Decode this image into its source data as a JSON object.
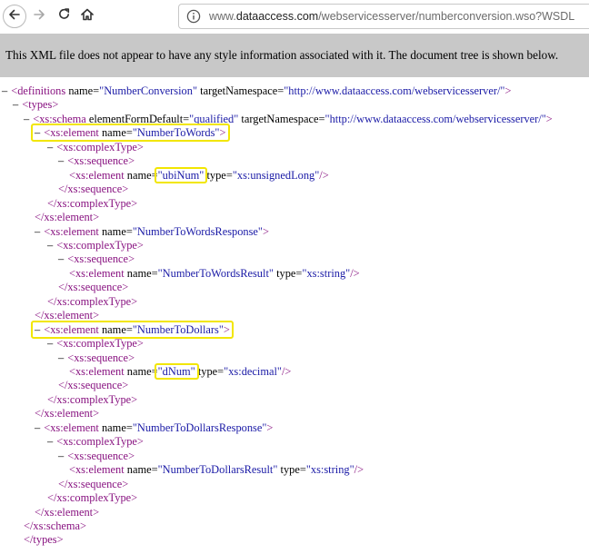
{
  "browser": {
    "back_icon": "arrow-left-icon",
    "forward_icon": "arrow-right-icon",
    "reload_icon": "reload-icon",
    "home_icon": "home-icon",
    "info_icon": "info-icon",
    "url_prefix": "www.",
    "url_main": "dataaccess.com",
    "url_rest": "/webservicesserver/numberconversion.wso?WSDL"
  },
  "banner": {
    "message": "This XML file does not appear to have any style information associated with it. The document tree is shown below."
  },
  "colors": {
    "tag": "#881280",
    "value": "#1a1aa6",
    "highlight": "#f2e600",
    "banner_bg": "#c8c8c8"
  },
  "xml_lines": [
    {
      "fold": "–",
      "tag": "<definitions",
      "attrs": [
        {
          "name": "name",
          "value": "NumberConversion"
        },
        {
          "name": "targetNamespace",
          "value": "http://www.dataaccess.com/webservicesserver/"
        }
      ],
      "end": ">"
    },
    {
      "fold": "–",
      "tag": "<types",
      "attrs": [],
      "end": ">"
    },
    {
      "fold": "–",
      "tag": "<xs:schema",
      "attrs": [
        {
          "name": "elementFormDefault",
          "value": "qualified"
        },
        {
          "name": "targetNamespace",
          "value": "http://www.dataaccess.com/webservicesserver/"
        }
      ],
      "end": ">"
    },
    {
      "fold": "–",
      "tag": "<xs:element",
      "attrs": [
        {
          "name": "name",
          "value": "NumberToWords"
        }
      ],
      "end": ">"
    },
    {
      "fold": "–",
      "tag": "<xs:complexType",
      "attrs": [],
      "end": ">"
    },
    {
      "fold": "–",
      "tag": "<xs:sequence",
      "attrs": [],
      "end": ">"
    },
    {
      "fold": "",
      "tag": "<xs:element",
      "attrs": [
        {
          "name": "name",
          "value": "ubiNum"
        },
        {
          "name": "type",
          "value": "xs:unsignedLong"
        }
      ],
      "end": "/>"
    },
    {
      "fold": "",
      "tag": "</xs:sequence",
      "attrs": [],
      "end": ">"
    },
    {
      "fold": "",
      "tag": "</xs:complexType",
      "attrs": [],
      "end": ">"
    },
    {
      "fold": "",
      "tag": "</xs:element",
      "attrs": [],
      "end": ">"
    },
    {
      "fold": "–",
      "tag": "<xs:element",
      "attrs": [
        {
          "name": "name",
          "value": "NumberToWordsResponse"
        }
      ],
      "end": ">"
    },
    {
      "fold": "–",
      "tag": "<xs:complexType",
      "attrs": [],
      "end": ">"
    },
    {
      "fold": "–",
      "tag": "<xs:sequence",
      "attrs": [],
      "end": ">"
    },
    {
      "fold": "",
      "tag": "<xs:element",
      "attrs": [
        {
          "name": "name",
          "value": "NumberToWordsResult"
        },
        {
          "name": "type",
          "value": "xs:string"
        }
      ],
      "end": "/>"
    },
    {
      "fold": "",
      "tag": "</xs:sequence",
      "attrs": [],
      "end": ">"
    },
    {
      "fold": "",
      "tag": "</xs:complexType",
      "attrs": [],
      "end": ">"
    },
    {
      "fold": "",
      "tag": "</xs:element",
      "attrs": [],
      "end": ">"
    },
    {
      "fold": "–",
      "tag": "<xs:element",
      "attrs": [
        {
          "name": "name",
          "value": "NumberToDollars"
        }
      ],
      "end": ">"
    },
    {
      "fold": "–",
      "tag": "<xs:complexType",
      "attrs": [],
      "end": ">"
    },
    {
      "fold": "–",
      "tag": "<xs:sequence",
      "attrs": [],
      "end": ">"
    },
    {
      "fold": "",
      "tag": "<xs:element",
      "attrs": [
        {
          "name": "name",
          "value": "dNum"
        },
        {
          "name": "type",
          "value": "xs:decimal"
        }
      ],
      "end": "/>"
    },
    {
      "fold": "",
      "tag": "</xs:sequence",
      "attrs": [],
      "end": ">"
    },
    {
      "fold": "",
      "tag": "</xs:complexType",
      "attrs": [],
      "end": ">"
    },
    {
      "fold": "",
      "tag": "</xs:element",
      "attrs": [],
      "end": ">"
    },
    {
      "fold": "–",
      "tag": "<xs:element",
      "attrs": [
        {
          "name": "name",
          "value": "NumberToDollarsResponse"
        }
      ],
      "end": ">"
    },
    {
      "fold": "–",
      "tag": "<xs:complexType",
      "attrs": [],
      "end": ">"
    },
    {
      "fold": "–",
      "tag": "<xs:sequence",
      "attrs": [],
      "end": ">"
    },
    {
      "fold": "",
      "tag": "<xs:element",
      "attrs": [
        {
          "name": "name",
          "value": "NumberToDollarsResult"
        },
        {
          "name": "type",
          "value": "xs:string"
        }
      ],
      "end": "/>"
    },
    {
      "fold": "",
      "tag": "</xs:sequence",
      "attrs": [],
      "end": ">"
    },
    {
      "fold": "",
      "tag": "</xs:complexType",
      "attrs": [],
      "end": ">"
    },
    {
      "fold": "",
      "tag": "</xs:element",
      "attrs": [],
      "end": ">"
    },
    {
      "fold": "",
      "tag": "</xs:schema",
      "attrs": [],
      "end": ">"
    },
    {
      "fold": "",
      "tag": "</types",
      "attrs": [],
      "end": ">"
    }
  ]
}
